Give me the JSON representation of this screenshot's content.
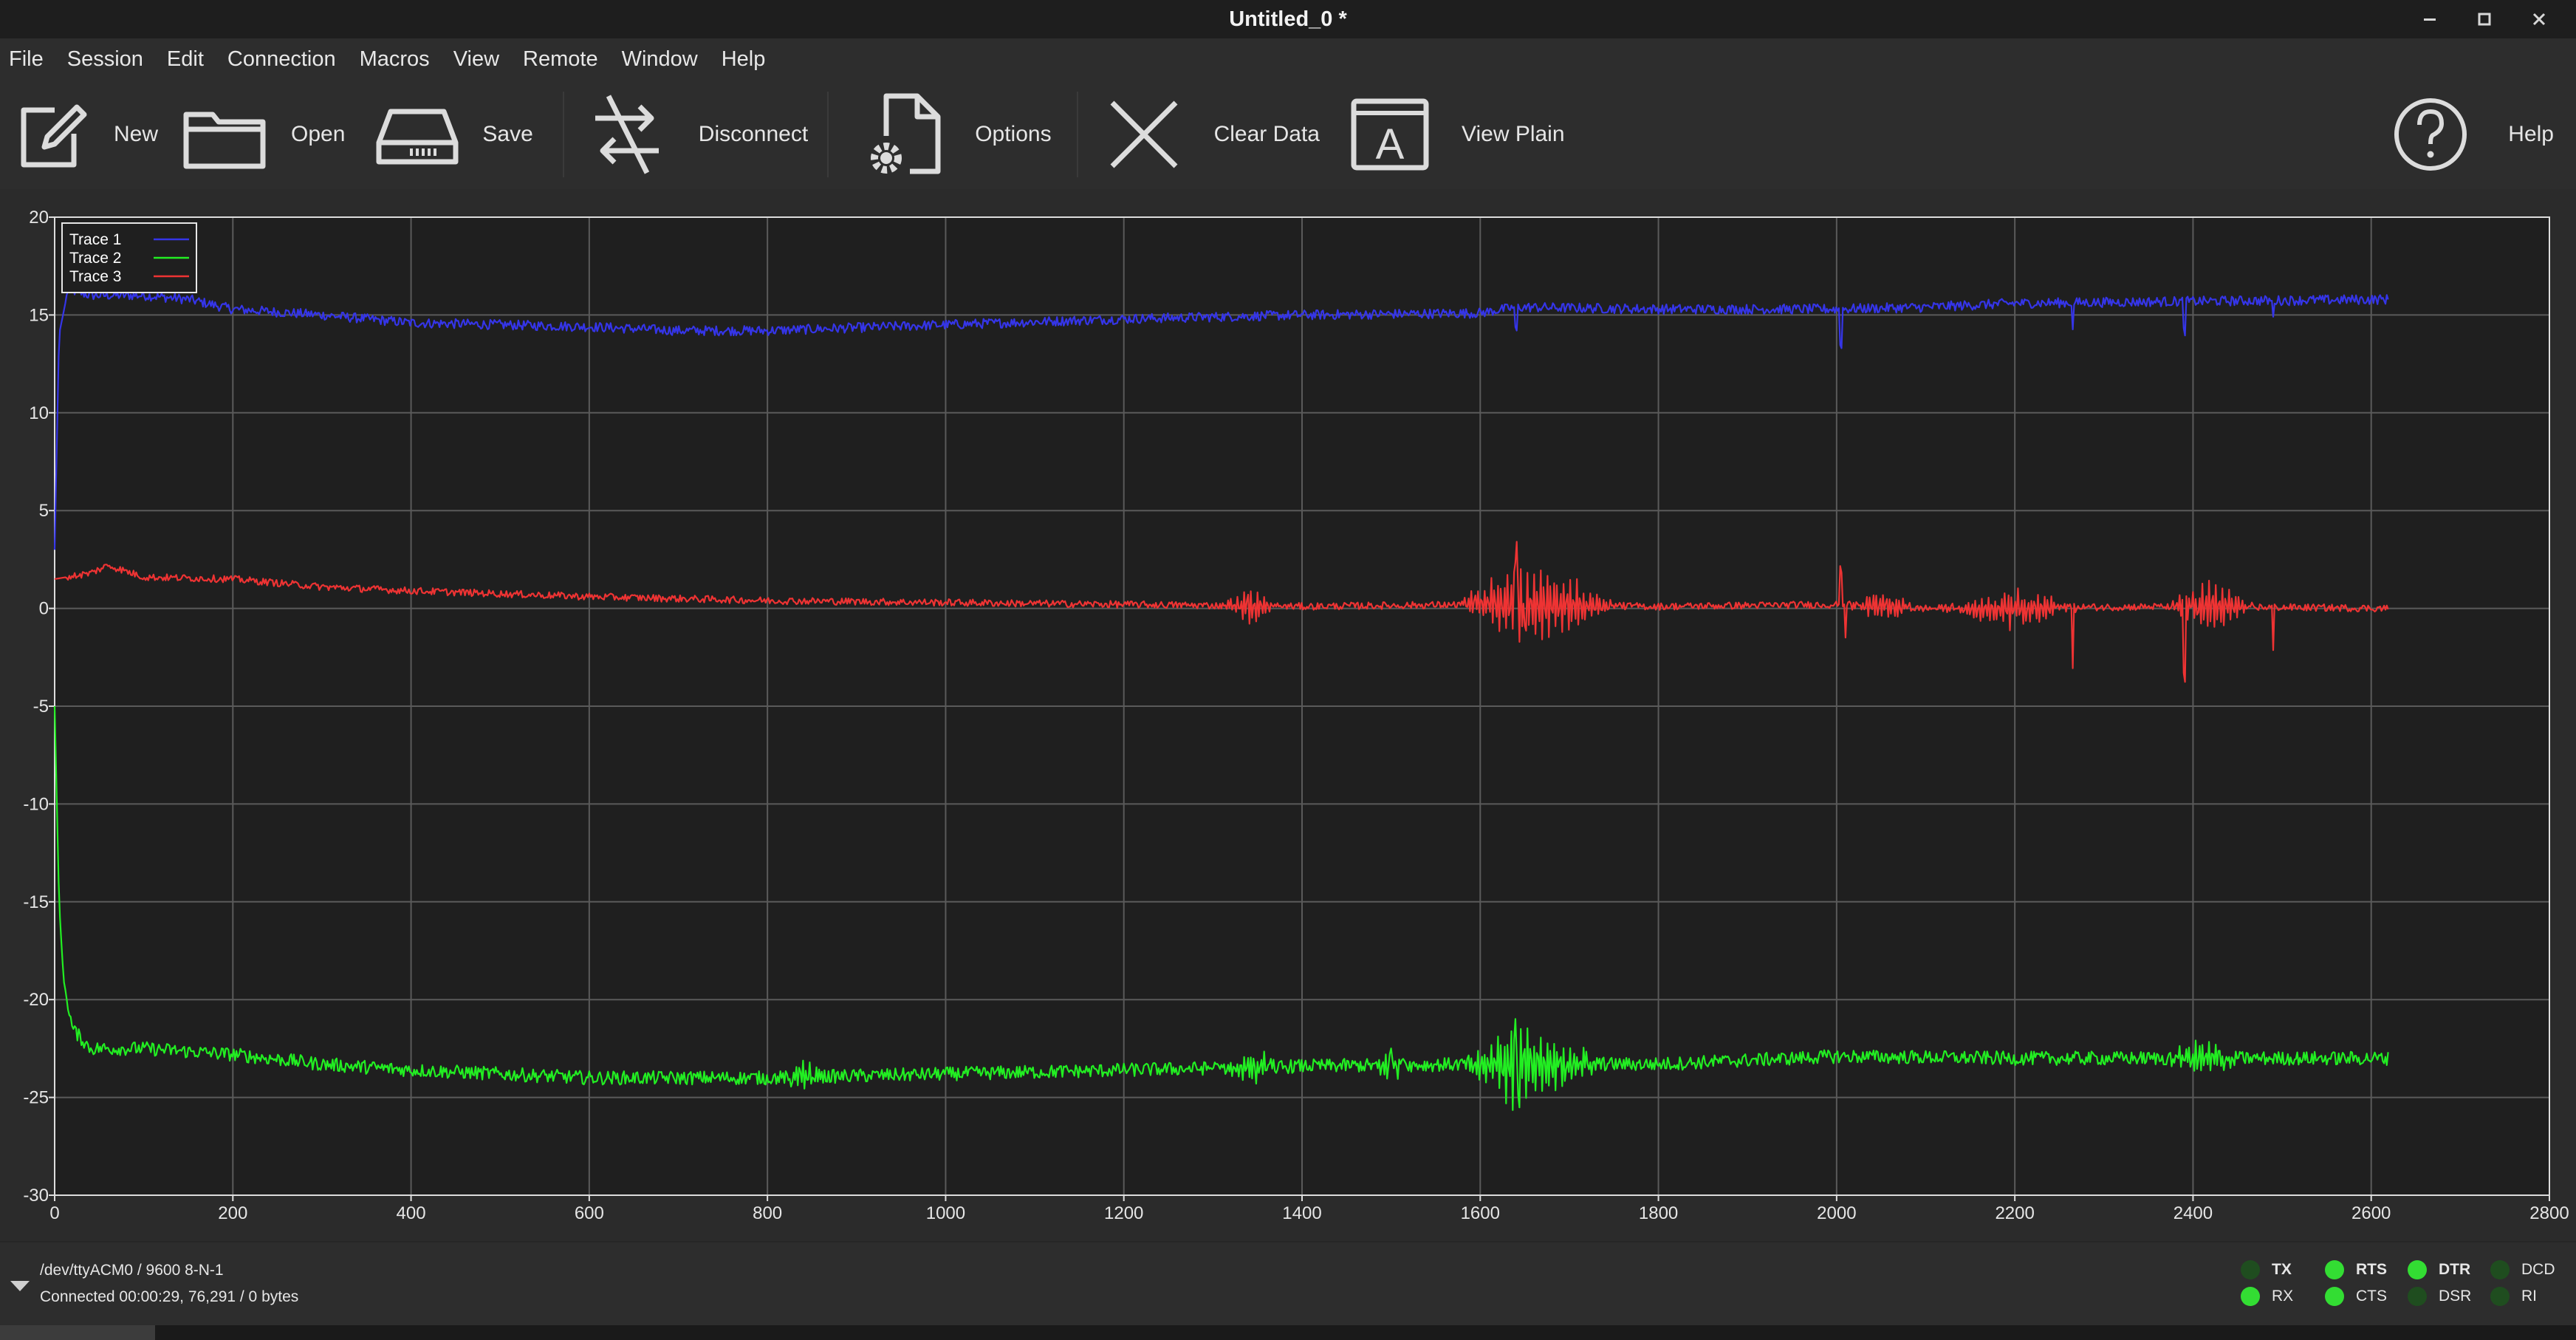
{
  "window": {
    "title": "Untitled_0 *"
  },
  "menu": [
    "File",
    "Session",
    "Edit",
    "Connection",
    "Macros",
    "View",
    "Remote",
    "Window",
    "Help"
  ],
  "toolbar": {
    "new": "New",
    "open": "Open",
    "save": "Save",
    "disconnect": "Disconnect",
    "options": "Options",
    "clear": "Clear Data",
    "view_plain": "View Plain",
    "help": "Help",
    "view_plain_glyph": "A"
  },
  "status": {
    "port": "/dev/ttyACM0 / 9600 8-N-1",
    "connection": "Connected 00:00:29, 76,291 / 0 bytes",
    "signals": [
      {
        "name": "TX",
        "on": false,
        "bold": true
      },
      {
        "name": "RX",
        "on": true,
        "bold": false
      },
      {
        "name": "RTS",
        "on": true,
        "bold": true
      },
      {
        "name": "CTS",
        "on": true,
        "bold": false
      },
      {
        "name": "DTR",
        "on": true,
        "bold": true
      },
      {
        "name": "DSR",
        "on": false,
        "bold": false
      },
      {
        "name": "DCD",
        "on": false,
        "bold": false
      },
      {
        "name": "RI",
        "on": false,
        "bold": false
      }
    ],
    "led_on_color": "#33dd33",
    "led_off_color": "#1f4d1f"
  },
  "chart_data": {
    "type": "line",
    "xlim": [
      0,
      2800
    ],
    "ylim": [
      -30,
      20
    ],
    "x_ticks": [
      0,
      200,
      400,
      600,
      800,
      1000,
      1200,
      1400,
      1600,
      1800,
      2000,
      2200,
      2400,
      2600,
      2800
    ],
    "y_ticks": [
      20,
      15,
      10,
      5,
      0,
      -5,
      -10,
      -15,
      -20,
      -25,
      -30
    ],
    "grid": true,
    "legend_position": "top-left",
    "background": "#1f1f1f",
    "series": [
      {
        "name": "Trace 1",
        "color": "#3535e8",
        "points": [
          [
            0,
            3
          ],
          [
            5,
            14
          ],
          [
            15,
            16.3
          ],
          [
            40,
            16
          ],
          [
            100,
            16
          ],
          [
            150,
            15.8
          ],
          [
            200,
            15.3
          ],
          [
            300,
            15
          ],
          [
            400,
            14.6
          ],
          [
            600,
            14.4
          ],
          [
            700,
            14.2
          ],
          [
            800,
            14.2
          ],
          [
            1000,
            14.5
          ],
          [
            1200,
            14.8
          ],
          [
            1400,
            15
          ],
          [
            1600,
            15.1
          ],
          [
            1640,
            15.4
          ],
          [
            1800,
            15.3
          ],
          [
            2000,
            15.3
          ],
          [
            2100,
            15.4
          ],
          [
            2200,
            15.6
          ],
          [
            2400,
            15.7
          ],
          [
            2620,
            15.8
          ]
        ],
        "noise": 0.25,
        "spikes": [
          [
            1640,
            -1.2
          ],
          [
            2005,
            -1.8
          ],
          [
            2265,
            -1.5
          ],
          [
            2390,
            -1.5
          ],
          [
            2490,
            -1.0
          ]
        ]
      },
      {
        "name": "Trace 2",
        "color": "#22ee22",
        "points": [
          [
            0,
            -5
          ],
          [
            5,
            -15
          ],
          [
            10,
            -19
          ],
          [
            20,
            -21.5
          ],
          [
            40,
            -22.5
          ],
          [
            100,
            -22.5
          ],
          [
            200,
            -22.8
          ],
          [
            300,
            -23.3
          ],
          [
            400,
            -23.6
          ],
          [
            500,
            -23.8
          ],
          [
            600,
            -24
          ],
          [
            800,
            -24
          ],
          [
            1000,
            -23.8
          ],
          [
            1200,
            -23.6
          ],
          [
            1400,
            -23.4
          ],
          [
            1600,
            -23.3
          ],
          [
            1800,
            -23.3
          ],
          [
            2000,
            -22.9
          ],
          [
            2200,
            -23
          ],
          [
            2400,
            -23
          ],
          [
            2620,
            -23
          ]
        ],
        "noise": 0.35,
        "bursts": [
          [
            840,
            20,
            0.8
          ],
          [
            1340,
            40,
            0.8
          ],
          [
            1500,
            20,
            1.0
          ],
          [
            1640,
            60,
            2.2
          ],
          [
            1700,
            40,
            1.0
          ],
          [
            2410,
            40,
            1.1
          ]
        ],
        "spikes": [
          [
            1500,
            1.6
          ],
          [
            1640,
            3.3
          ],
          [
            1642,
            -2.8
          ]
        ]
      },
      {
        "name": "Trace 3",
        "color": "#ee3333",
        "points": [
          [
            0,
            1.5
          ],
          [
            40,
            1.8
          ],
          [
            60,
            2.2
          ],
          [
            100,
            1.6
          ],
          [
            200,
            1.5
          ],
          [
            300,
            1.1
          ],
          [
            400,
            0.9
          ],
          [
            600,
            0.6
          ],
          [
            800,
            0.4
          ],
          [
            1000,
            0.3
          ],
          [
            1200,
            0.2
          ],
          [
            1400,
            0.1
          ],
          [
            1600,
            0.2
          ],
          [
            1800,
            0.1
          ],
          [
            2000,
            0.2
          ],
          [
            2100,
            0.0
          ],
          [
            2400,
            0.1
          ],
          [
            2620,
            0.0
          ]
        ],
        "noise": 0.18,
        "bursts": [
          [
            1340,
            30,
            1.0
          ],
          [
            1640,
            70,
            1.8
          ],
          [
            1700,
            60,
            1.2
          ],
          [
            2050,
            40,
            0.8
          ],
          [
            2200,
            80,
            0.9
          ],
          [
            2420,
            50,
            1.3
          ]
        ],
        "spikes": [
          [
            1640,
            3.3
          ],
          [
            1650,
            -1.8
          ],
          [
            2005,
            1.8
          ],
          [
            2010,
            -1.6
          ],
          [
            2265,
            -3.0
          ],
          [
            2390,
            -3.5
          ],
          [
            2490,
            -2.2
          ]
        ]
      }
    ]
  }
}
